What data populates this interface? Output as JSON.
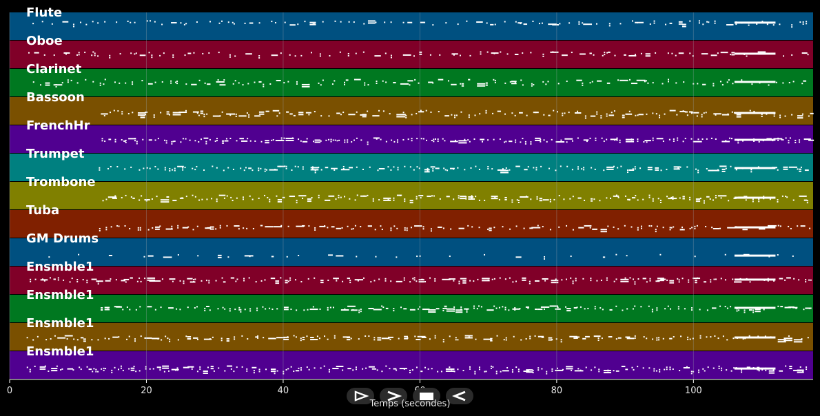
{
  "tracks": [
    {
      "name": "Flute",
      "color": "#005080",
      "density": 0.35,
      "start": 2,
      "level": 0.35,
      "spread": 0.15
    },
    {
      "name": "Oboe",
      "color": "#800028",
      "density": 0.35,
      "start": 2,
      "level": 0.45,
      "spread": 0.15
    },
    {
      "name": "Clarinet",
      "color": "#007820",
      "density": 0.45,
      "start": 2,
      "level": 0.45,
      "spread": 0.2
    },
    {
      "name": "Bassoon",
      "color": "#7a5000",
      "density": 0.6,
      "start": 12.8,
      "level": 0.55,
      "spread": 0.2
    },
    {
      "name": "FrenchHr",
      "color": "#500090",
      "density": 0.8,
      "start": 12.8,
      "level": 0.5,
      "spread": 0.15
    },
    {
      "name": "Trumpet",
      "color": "#008080",
      "density": 0.55,
      "start": 12.8,
      "level": 0.5,
      "spread": 0.15
    },
    {
      "name": "Trombone",
      "color": "#808000",
      "density": 0.7,
      "start": 12.8,
      "level": 0.55,
      "spread": 0.2
    },
    {
      "name": "Tuba",
      "color": "#802000",
      "density": 0.55,
      "start": 12.8,
      "level": 0.6,
      "spread": 0.15
    },
    {
      "name": "GM Drums",
      "color": "#005080",
      "density": 0.12,
      "start": 0.5,
      "level": 0.6,
      "spread": 0.1
    },
    {
      "name": "Ensmble1",
      "color": "#800028",
      "density": 0.65,
      "start": 2,
      "level": 0.45,
      "spread": 0.15
    },
    {
      "name": "Ensmble1",
      "color": "#007820",
      "density": 0.6,
      "start": 12.8,
      "level": 0.45,
      "spread": 0.15
    },
    {
      "name": "Ensmble1",
      "color": "#7a5000",
      "density": 0.55,
      "start": 2,
      "level": 0.5,
      "spread": 0.15
    },
    {
      "name": "Ensmble1",
      "color": "#500090",
      "density": 0.8,
      "start": 2,
      "level": 0.6,
      "spread": 0.2
    }
  ],
  "x_axis": {
    "label": "Temps (secondes)",
    "min": 0,
    "max": 117.5,
    "ticks": [
      0,
      20,
      40,
      60,
      80,
      100
    ]
  },
  "transport": [
    {
      "id": "play",
      "icon": "play-icon"
    },
    {
      "id": "forward",
      "icon": "forward-icon"
    },
    {
      "id": "stop",
      "icon": "stop-icon"
    },
    {
      "id": "rewind",
      "icon": "rewind-icon"
    }
  ],
  "colors": {
    "background": "#000000",
    "note": "#ffffff",
    "grid": "#9aa6b0",
    "label": "#ffffff"
  }
}
